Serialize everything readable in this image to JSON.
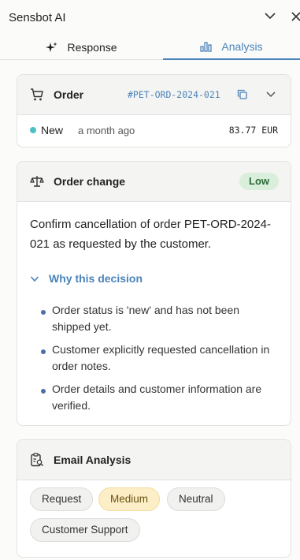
{
  "header": {
    "title": "Sensbot AI"
  },
  "tabs": [
    {
      "label": "Response",
      "active": false
    },
    {
      "label": "Analysis",
      "active": true
    }
  ],
  "order": {
    "title": "Order",
    "id": "#PET-ORD-2024-021",
    "status": "New",
    "time": "a month ago",
    "amount": "83.77 EUR"
  },
  "change": {
    "title": "Order change",
    "severity": "Low",
    "summary": "Confirm cancellation of order PET-ORD-2024-021 as requested by the customer.",
    "why_label": "Why this decision",
    "reasons": [
      "Order status is 'new' and has not been shipped yet.",
      "Customer explicitly requested cancellation in order notes.",
      "Order details and customer information are verified."
    ]
  },
  "email": {
    "title": "Email Analysis",
    "tags": [
      "Request",
      "Medium",
      "Neutral",
      "Customer Support"
    ]
  },
  "colors": {
    "accent": "#4b83b8",
    "status_new": "#4cc1c4",
    "badge_low_bg": "#d9efdb",
    "chip_medium_bg": "#fcefc8"
  }
}
